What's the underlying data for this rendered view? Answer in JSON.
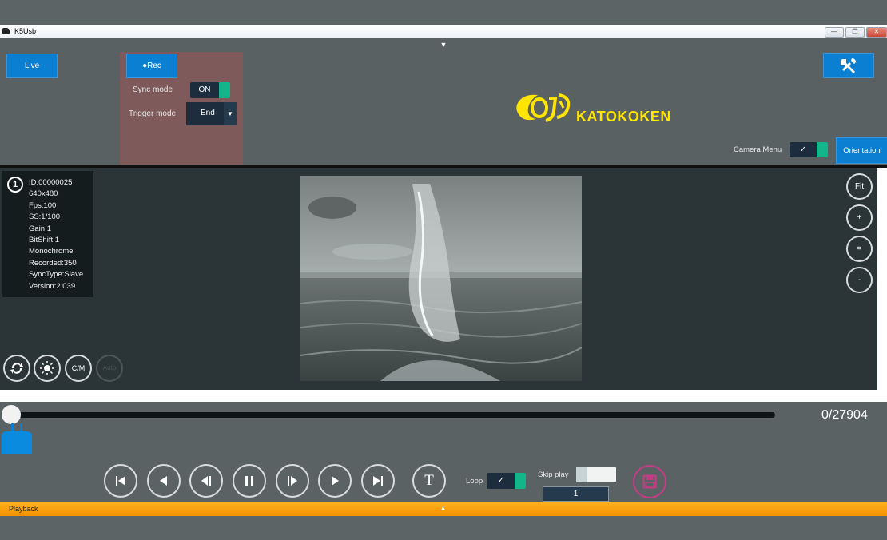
{
  "window": {
    "title": "K5Usb",
    "minimize": "—",
    "restore": "❐",
    "close": "✕"
  },
  "collapse_arrow": "▼",
  "toolbar": {
    "live_label": "Live",
    "rec_label": "●Rec",
    "sync_mode_label": "Sync mode",
    "sync_mode_value": "ON",
    "trigger_mode_label": "Trigger mode",
    "trigger_mode_value": "End",
    "trigger_arrow": "▼",
    "logo_text": "KATOKOKEN",
    "camera_menu_label": "Camera Menu",
    "camera_menu_check": "✓",
    "orientation_label": "Orientation",
    "settings_icon": "tools-icon"
  },
  "camera_info": {
    "number": "1",
    "lines": [
      "ID:00000025",
      "640x480",
      "Fps:100",
      "SS:1/100",
      "Gain:1",
      "BitShift:1",
      "Monochrome",
      "Recorded:350",
      "SyncType:Slave",
      "Version:2.039"
    ]
  },
  "view_controls": {
    "fit": "Fit",
    "zoom_in": "+",
    "reset": "=",
    "zoom_out": "-"
  },
  "bottom_tools": {
    "cm_label": "C/M",
    "auto_label": "Auto"
  },
  "timeline": {
    "frame_counter": "0/27904",
    "position": 0
  },
  "playback": {
    "loop_label": "Loop",
    "loop_check": "✓",
    "skip_play_label": "Skip play",
    "skip_value": "1",
    "text_button": "T",
    "bar_label": "Playback",
    "bar_arrow": "▲"
  },
  "colors": {
    "accent_blue": "#0b7fd1",
    "toggle_green": "#14b58a",
    "logo_yellow": "#ffe500",
    "playback_orange": "#f39100",
    "save_pink": "#c33d86"
  }
}
